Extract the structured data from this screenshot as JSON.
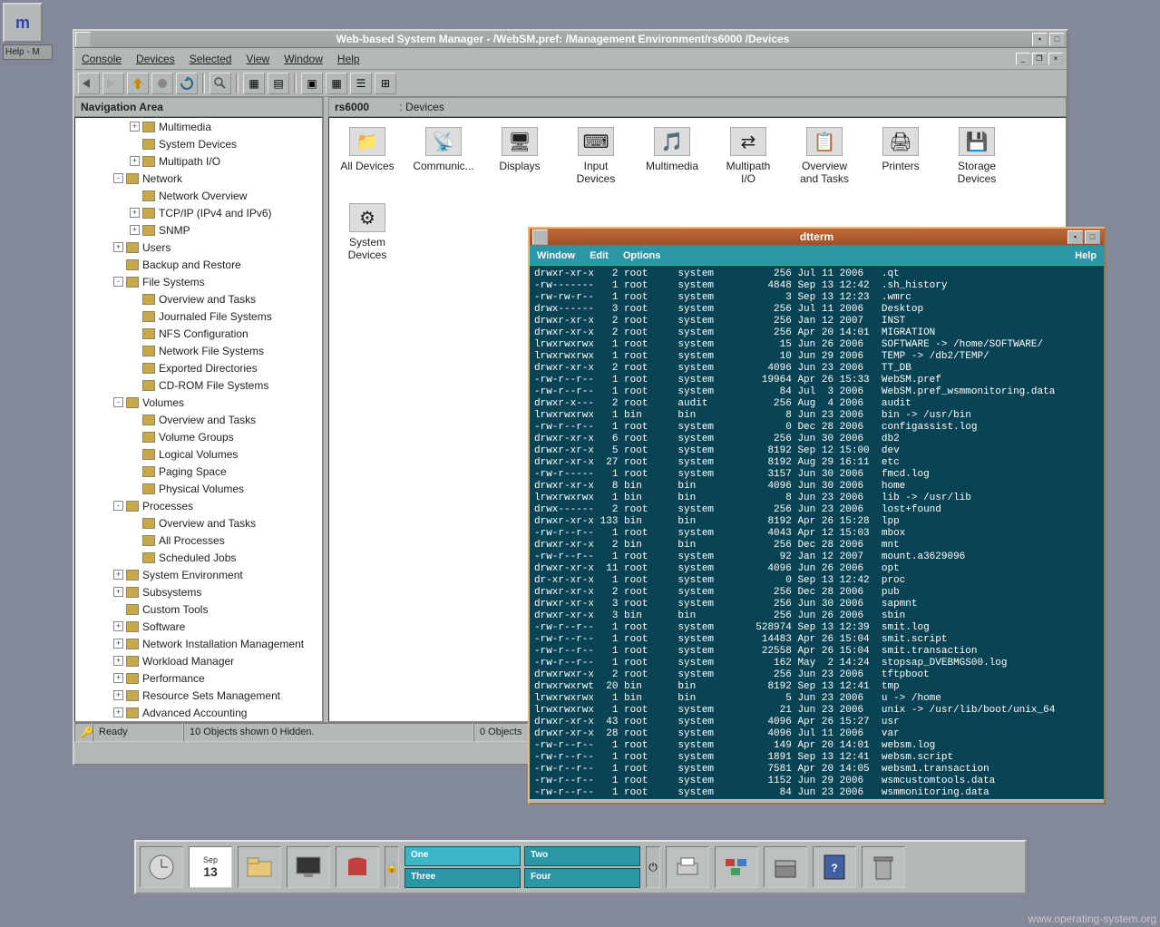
{
  "help_widget": {
    "title": "Help - M"
  },
  "wsm": {
    "title": "Web-based System Manager - /WebSM.pref: /Management Environment/rs6000     /Devices",
    "menus": [
      "Console",
      "Devices",
      "Selected",
      "View",
      "Window",
      "Help"
    ],
    "nav_title": "Navigation Area",
    "content_title_host": "rs6000",
    "content_title_sep": ": Devices",
    "tree": [
      {
        "d": 3,
        "e": "+",
        "label": "Multimedia",
        "icon": "mm"
      },
      {
        "d": 3,
        "e": "",
        "label": "System Devices",
        "icon": "sys"
      },
      {
        "d": 3,
        "e": "+",
        "label": "Multipath I/O",
        "icon": "mp"
      },
      {
        "d": 2,
        "e": "-",
        "label": "Network",
        "icon": "net"
      },
      {
        "d": 3,
        "e": "",
        "label": "Network Overview",
        "icon": "doc"
      },
      {
        "d": 3,
        "e": "+",
        "label": "TCP/IP (IPv4 and IPv6)",
        "icon": "tcp"
      },
      {
        "d": 3,
        "e": "+",
        "label": "SNMP",
        "icon": "snmp"
      },
      {
        "d": 2,
        "e": "+",
        "label": "Users",
        "icon": "users"
      },
      {
        "d": 2,
        "e": "",
        "label": "Backup and Restore",
        "icon": "bk"
      },
      {
        "d": 2,
        "e": "-",
        "label": "File Systems",
        "icon": "fs"
      },
      {
        "d": 3,
        "e": "",
        "label": "Overview and Tasks",
        "icon": "doc"
      },
      {
        "d": 3,
        "e": "",
        "label": "Journaled File Systems",
        "icon": "fs"
      },
      {
        "d": 3,
        "e": "",
        "label": "NFS Configuration",
        "icon": "fs"
      },
      {
        "d": 3,
        "e": "",
        "label": "Network File Systems",
        "icon": "fs"
      },
      {
        "d": 3,
        "e": "",
        "label": "Exported Directories",
        "icon": "fs"
      },
      {
        "d": 3,
        "e": "",
        "label": "CD-ROM File Systems",
        "icon": "cd"
      },
      {
        "d": 2,
        "e": "-",
        "label": "Volumes",
        "icon": "vol"
      },
      {
        "d": 3,
        "e": "",
        "label": "Overview and Tasks",
        "icon": "doc"
      },
      {
        "d": 3,
        "e": "",
        "label": "Volume Groups",
        "icon": "vol"
      },
      {
        "d": 3,
        "e": "",
        "label": "Logical Volumes",
        "icon": "vol"
      },
      {
        "d": 3,
        "e": "",
        "label": "Paging Space",
        "icon": "vol"
      },
      {
        "d": 3,
        "e": "",
        "label": "Physical Volumes",
        "icon": "vol"
      },
      {
        "d": 2,
        "e": "-",
        "label": "Processes",
        "icon": "proc"
      },
      {
        "d": 3,
        "e": "",
        "label": "Overview and Tasks",
        "icon": "doc"
      },
      {
        "d": 3,
        "e": "",
        "label": "All Processes",
        "icon": "proc"
      },
      {
        "d": 3,
        "e": "",
        "label": "Scheduled Jobs",
        "icon": "proc"
      },
      {
        "d": 2,
        "e": "+",
        "label": "System Environment",
        "icon": "env"
      },
      {
        "d": 2,
        "e": "+",
        "label": "Subsystems",
        "icon": "sub"
      },
      {
        "d": 2,
        "e": "",
        "label": "Custom Tools",
        "icon": "tool"
      },
      {
        "d": 2,
        "e": "+",
        "label": "Software",
        "icon": "sw"
      },
      {
        "d": 2,
        "e": "+",
        "label": "Network Installation Management",
        "icon": "nim"
      },
      {
        "d": 2,
        "e": "+",
        "label": "Workload Manager",
        "icon": "wlm"
      },
      {
        "d": 2,
        "e": "+",
        "label": "Performance",
        "icon": "perf"
      },
      {
        "d": 2,
        "e": "+",
        "label": "Resource Sets Management",
        "icon": "res"
      },
      {
        "d": 2,
        "e": "+",
        "label": "Advanced Accounting",
        "icon": "acc"
      }
    ],
    "devices": [
      {
        "label": "All Devices"
      },
      {
        "label": "Communic..."
      },
      {
        "label": "Displays"
      },
      {
        "label": "Input Devices"
      },
      {
        "label": "Multimedia"
      },
      {
        "label": "Multipath I/O"
      },
      {
        "label": "Overview and Tasks"
      },
      {
        "label": "Printers"
      },
      {
        "label": "Storage Devices"
      },
      {
        "label": "System Devices"
      }
    ],
    "status_ready": "Ready",
    "status_objects": "10 Objects shown 0 Hidden.",
    "status_right": "0 Objects"
  },
  "dtterm": {
    "title": "dtterm",
    "menus": [
      "Window",
      "Edit",
      "Options"
    ],
    "help": "Help",
    "lines": [
      "drwxr-xr-x   2 root     system          256 Jul 11 2006   .qt",
      "-rw-------   1 root     system         4848 Sep 13 12:42  .sh_history",
      "-rw-rw-r--   1 root     system            3 Sep 13 12:23  .wmrc",
      "drwx------   3 root     system          256 Jul 11 2006   Desktop",
      "drwxr-xr-x   2 root     system          256 Jan 12 2007   INST",
      "drwxr-xr-x   2 root     system          256 Apr 20 14:01  MIGRATION",
      "lrwxrwxrwx   1 root     system           15 Jun 26 2006   SOFTWARE -> /home/SOFTWARE/",
      "lrwxrwxrwx   1 root     system           10 Jun 29 2006   TEMP -> /db2/TEMP/",
      "drwxr-xr-x   2 root     system         4096 Jun 23 2006   TT_DB",
      "-rw-r--r--   1 root     system        19964 Apr 26 15:33  WebSM.pref",
      "-rw-r--r--   1 root     system           84 Jul  3 2006   WebSM.pref_wsmmonitoring.data",
      "drwxr-x---   2 root     audit           256 Aug  4 2006   audit",
      "lrwxrwxrwx   1 bin      bin               8 Jun 23 2006   bin -> /usr/bin",
      "-rw-r--r--   1 root     system            0 Dec 28 2006   configassist.log",
      "drwxr-xr-x   6 root     system          256 Jun 30 2006   db2",
      "drwxr-xr-x   5 root     system         8192 Sep 12 15:00  dev",
      "drwxr-xr-x  27 root     system         8192 Aug 29 16:11  etc",
      "-rw-r-----   1 root     system         3157 Jun 30 2006   fmcd.log",
      "drwxr-xr-x   8 bin      bin            4096 Jun 30 2006   home",
      "lrwxrwxrwx   1 bin      bin               8 Jun 23 2006   lib -> /usr/lib",
      "drwx------   2 root     system          256 Jun 23 2006   lost+found",
      "drwxr-xr-x 133 bin      bin            8192 Apr 26 15:28  lpp",
      "-rw-r--r--   1 root     system         4043 Apr 12 15:03  mbox",
      "drwxr-xr-x   2 bin      bin             256 Dec 28 2006   mnt",
      "-rw-r--r--   1 root     system           92 Jan 12 2007   mount.a3629096",
      "drwxr-xr-x  11 root     system         4096 Jun 26 2006   opt",
      "dr-xr-xr-x   1 root     system            0 Sep 13 12:42  proc",
      "drwxr-xr-x   2 root     system          256 Dec 28 2006   pub",
      "drwxr-xr-x   3 root     system          256 Jun 30 2006   sapmnt",
      "drwxr-xr-x   3 bin      bin             256 Jun 26 2006   sbin",
      "-rw-r--r--   1 root     system       528974 Sep 13 12:39  smit.log",
      "-rw-r--r--   1 root     system        14483 Apr 26 15:04  smit.script",
      "-rw-r--r--   1 root     system        22558 Apr 26 15:04  smit.transaction",
      "-rw-r--r--   1 root     system          162 May  2 14:24  stopsap_DVEBMGS00.log",
      "drwxrwxr-x   2 root     system          256 Jun 23 2006   tftpboot",
      "drwxrwxrwt  20 bin      bin            8192 Sep 13 12:41  tmp",
      "lrwxrwxrwx   1 bin      bin               5 Jun 23 2006   u -> /home",
      "lrwxrwxrwx   1 root     system           21 Jun 23 2006   unix -> /usr/lib/boot/unix_64",
      "drwxr-xr-x  43 root     system         4096 Apr 26 15:27  usr",
      "drwxr-xr-x  28 root     system         4096 Jul 11 2006   var",
      "-rw-r--r--   1 root     system          149 Apr 20 14:01  websm.log",
      "-rw-r--r--   1 root     system         1891 Sep 13 12:41  websm.script",
      "-rw-r--r--   1 root     system         7581 Apr 20 14:05  websm1.transaction",
      "-rw-r--r--   1 root     system         1152 Jun 29 2006   wsmcustomtools.data",
      "-rw-r--r--   1 root     system           84 Jun 23 2006   wsmmonitoring.data",
      "# "
    ]
  },
  "taskbar": {
    "calendar": {
      "month": "Sep",
      "day": "13"
    },
    "workspaces": [
      [
        "One",
        "Two"
      ],
      [
        "Three",
        "Four"
      ]
    ],
    "active_ws": "One"
  },
  "footer": "www.operating-system.org"
}
